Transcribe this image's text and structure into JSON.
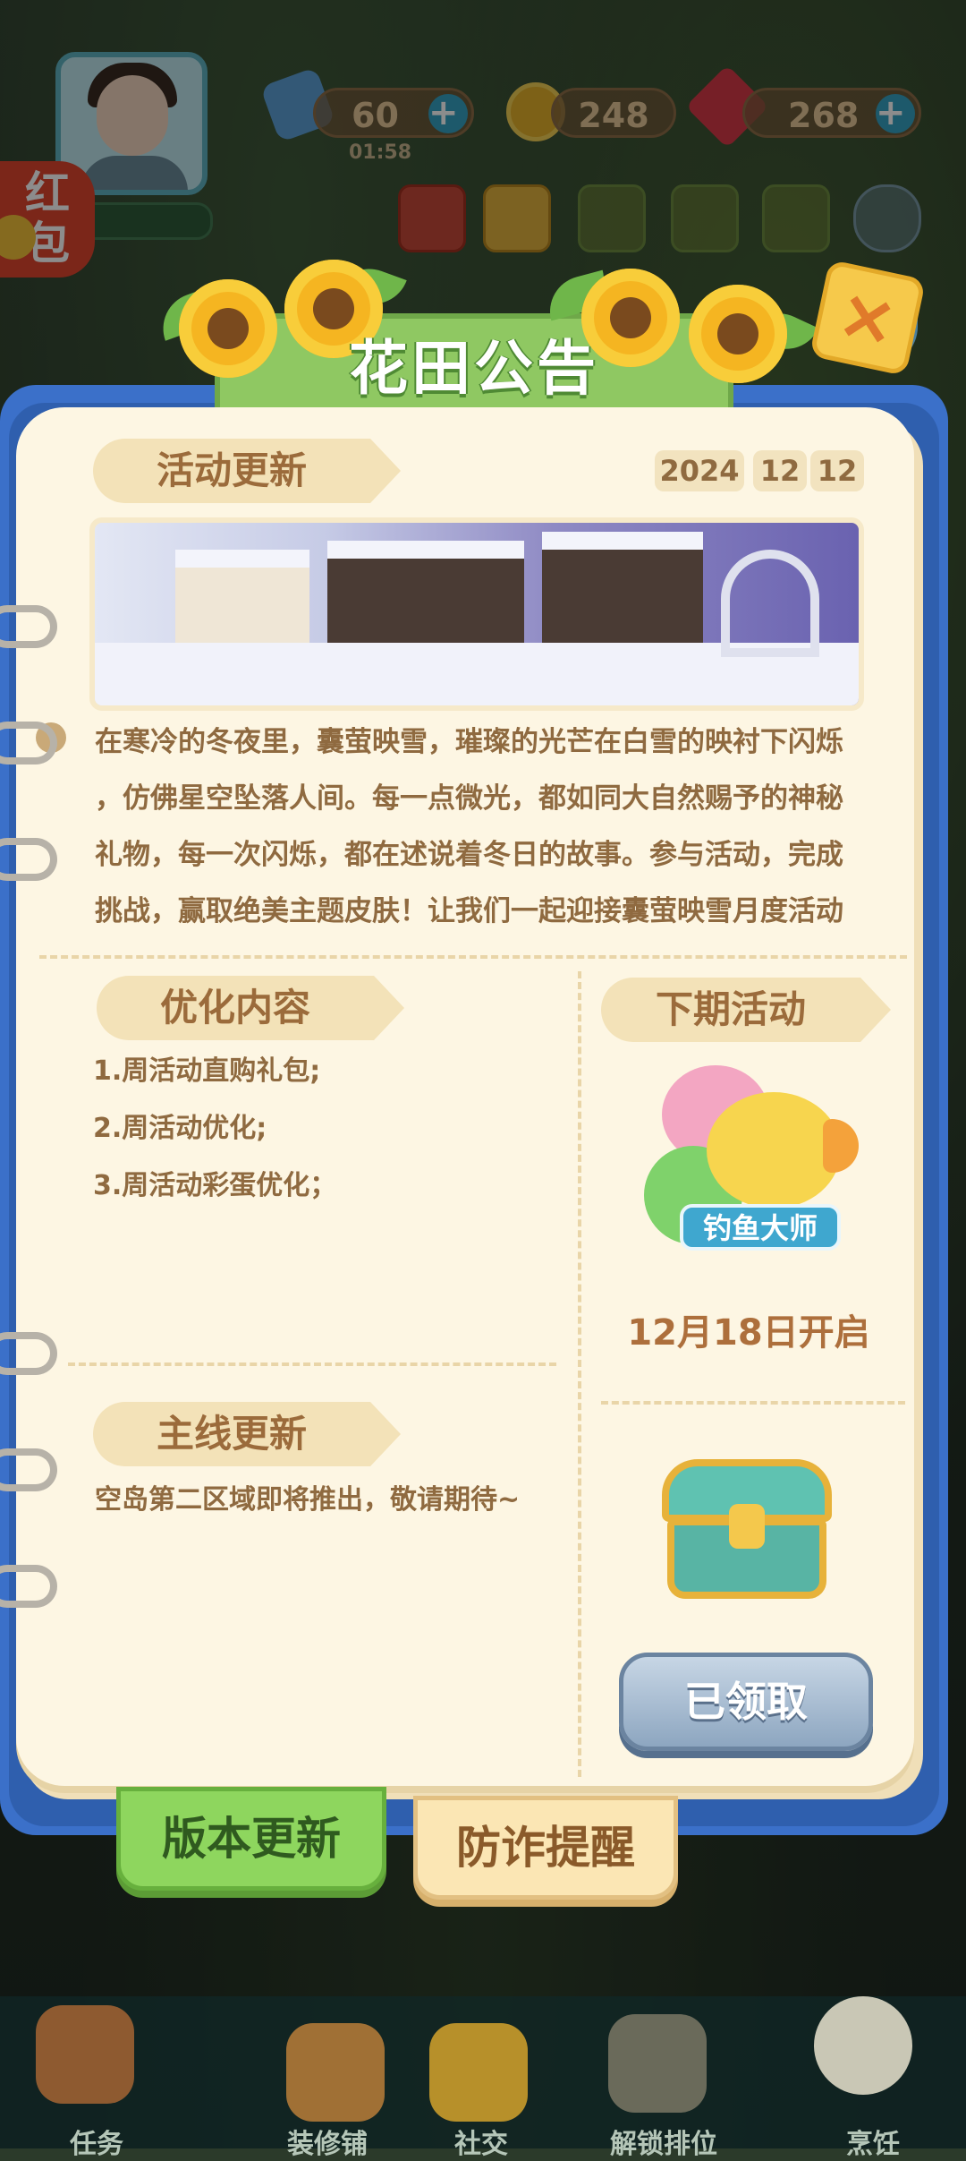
{
  "hud": {
    "energy": "60",
    "energy_timer": "01:58",
    "coins": "248",
    "gems": "268",
    "red_packet": "红包"
  },
  "notice": {
    "title": "花田公告",
    "close_label": "×",
    "activity_update": {
      "heading": "活动更新",
      "date_year": "2024",
      "date_month": "12",
      "date_day": "12",
      "text_lines": [
        "在寒冷的冬夜里，囊萤映雪，璀璨的光芒在白雪的映衬下闪烁",
        "，仿佛星空坠落人间。每一点微光，都如同大自然赐予的神秘",
        "礼物，每一次闪烁，都在述说着冬日的故事。参与活动，完成",
        "挑战，赢取绝美主题皮肤！让我们一起迎接囊萤映雪月度活动"
      ]
    },
    "optimization": {
      "heading": "优化内容",
      "items": [
        "1.周活动直购礼包;",
        "2.周活动优化;",
        "3.周活动彩蛋优化；"
      ]
    },
    "main_update": {
      "heading": "主线更新",
      "text": "空岛第二区域即将推出，敬请期待~"
    },
    "next_event": {
      "heading": "下期活动",
      "event_name": "钓鱼大师",
      "start_date": "12月18日开启"
    },
    "reward": {
      "claim_label": "已领取"
    },
    "tabs": [
      {
        "label": "版本更新",
        "active": true
      },
      {
        "label": "防诈提醒",
        "active": false
      }
    ]
  },
  "bottom_nav": [
    {
      "label": "任务"
    },
    {
      "label": "装修铺"
    },
    {
      "label": "社交"
    },
    {
      "label": "解锁排位"
    },
    {
      "label": "烹饪"
    }
  ],
  "colors": {
    "accent_green": "#8fc862",
    "paper": "#fdf6e3",
    "text_brown": "#8f6a40",
    "book_blue": "#3b70c9"
  }
}
